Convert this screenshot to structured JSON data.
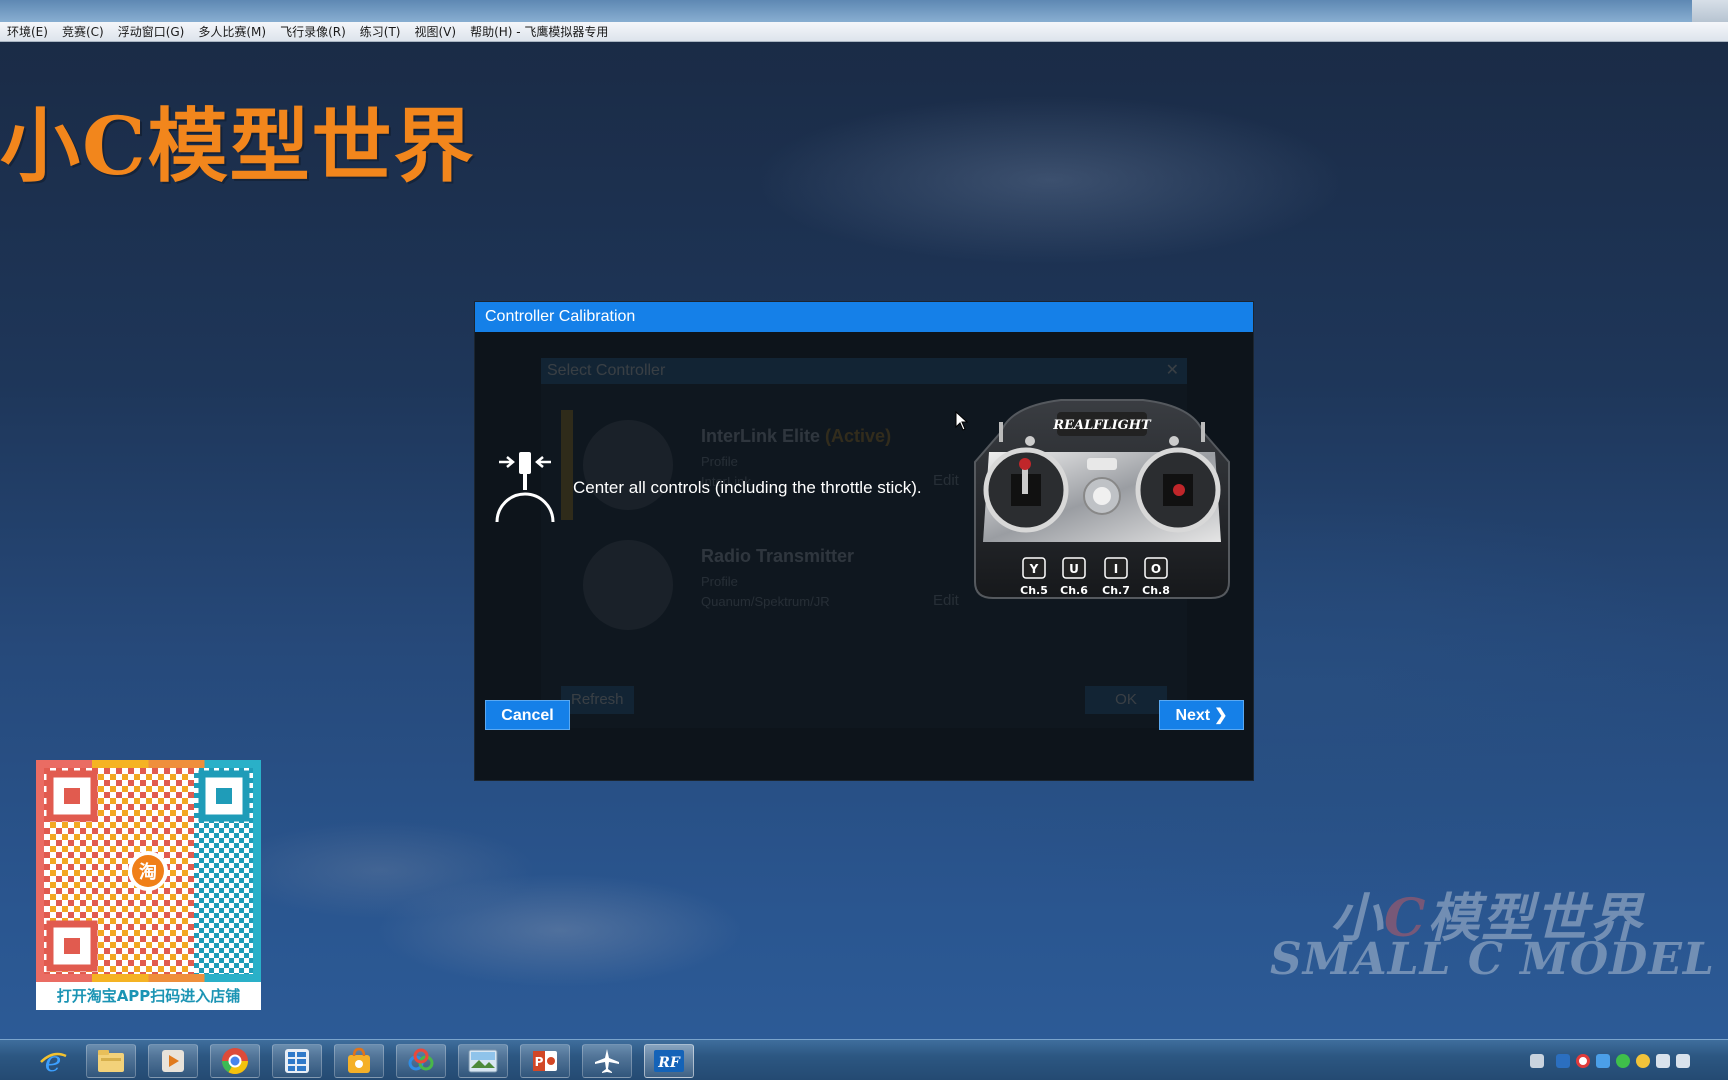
{
  "app": {
    "menu": [
      "环境(E)",
      "竞赛(C)",
      "浮动窗口(G)",
      "多人比赛(M)",
      "飞行录像(R)",
      "练习(T)",
      "视图(V)",
      "帮助(H) - 飞鹰模拟器专用"
    ],
    "brand_title": "小C模型世界"
  },
  "dialog": {
    "title": "Controller Calibration",
    "instruction": "Center all controls (including the throttle stick).",
    "cancel_label": "Cancel",
    "next_label": "Next",
    "transmitter": {
      "brand": "REALFLIGHT",
      "keys": [
        "Y",
        "U",
        "I",
        "O"
      ],
      "channels": [
        "Ch.5",
        "Ch.6",
        "Ch.7",
        "Ch.8"
      ]
    }
  },
  "background_dialog": {
    "title": "Select Controller",
    "items": [
      {
        "name": "InterLink Elite",
        "status": "(Active)",
        "profile_label": "Profile",
        "profile_value": "InterLink",
        "edit": "Edit"
      },
      {
        "name": "Radio Transmitter",
        "status": "",
        "profile_label": "Profile",
        "profile_value": "Quanum/Spektrum/JR",
        "edit": "Edit"
      }
    ],
    "refresh_label": "Refresh",
    "ok_label": "OK"
  },
  "qr": {
    "center_char": "淘",
    "caption": "打开淘宝APP扫码进入店铺"
  },
  "watermark": {
    "cn_prefix": "小",
    "cn_c": "C",
    "cn_suffix": "模型世界",
    "en": "SMALL C MODEL"
  },
  "taskbar": {
    "apps": [
      "ie",
      "explorer",
      "media-player",
      "chrome",
      "app-grid",
      "store",
      "baidu-cloud",
      "photo-viewer",
      "powerpoint",
      "flight-sim",
      "realflight"
    ],
    "realflight_label": "RF"
  }
}
